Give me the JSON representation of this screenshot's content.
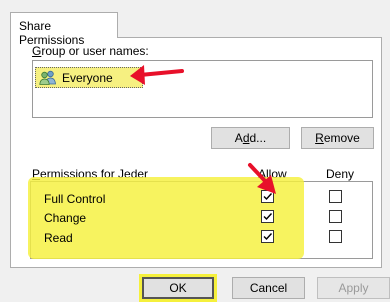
{
  "tab": {
    "label": "Share Permissions"
  },
  "group_section": {
    "label": "Group or user names:",
    "label_mnemonic": "G",
    "label_rest": "roup or user names:",
    "users": [
      {
        "name": "Everyone",
        "icon": "users-group-icon",
        "selected": true
      }
    ]
  },
  "buttons": {
    "add_prefix": "A",
    "add_mnemonic": "d",
    "add_suffix": "d...",
    "remove_mnemonic": "R",
    "remove_rest": "emove",
    "ok": "OK",
    "cancel": "Cancel",
    "apply": "Apply"
  },
  "permissions": {
    "label_mnemonic": "P",
    "label_rest": "ermissions for Jeder",
    "col_allow": "Allow",
    "col_deny": "Deny",
    "rows": [
      {
        "name": "Full Control",
        "allow": true,
        "deny": false
      },
      {
        "name": "Change",
        "allow": true,
        "deny": false
      },
      {
        "name": "Read",
        "allow": true,
        "deny": false
      }
    ]
  },
  "annotations": {
    "highlight_color": "#f5f03c",
    "arrow_color": "#e8102a"
  }
}
